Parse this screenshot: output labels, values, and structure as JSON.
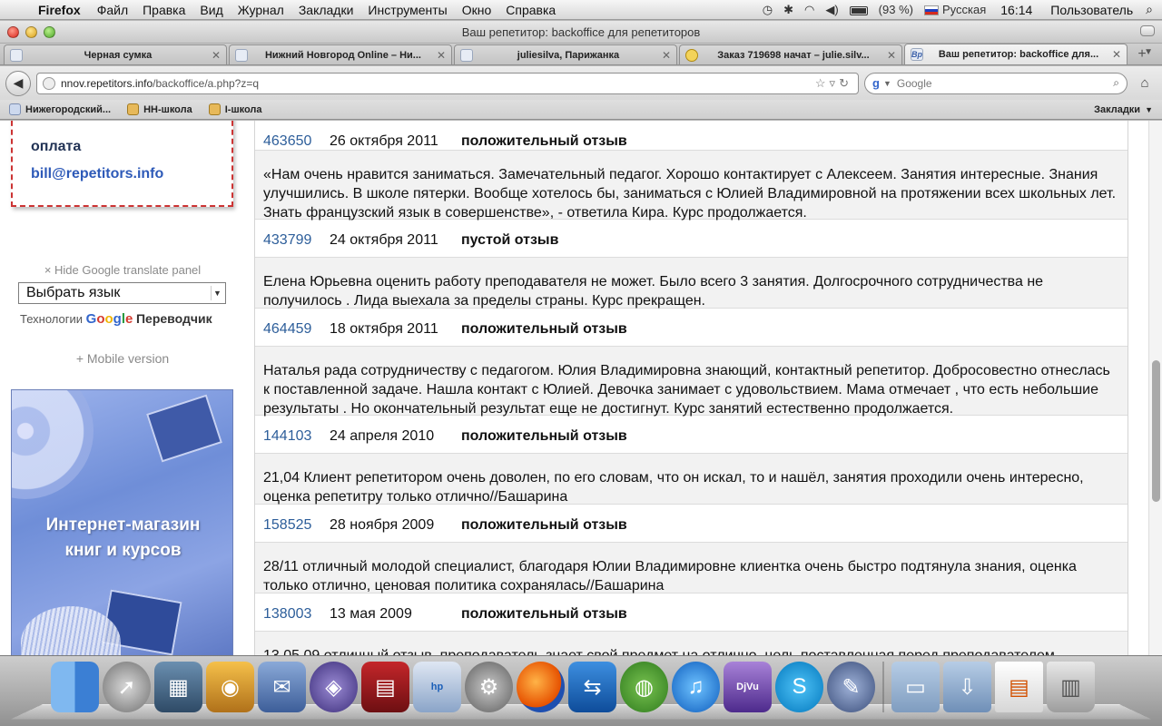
{
  "menubar": {
    "app": "Firefox",
    "items": [
      "Файл",
      "Правка",
      "Вид",
      "Журнал",
      "Закладки",
      "Инструменты",
      "Окно",
      "Справка"
    ],
    "battery": "(93 %)",
    "input_lang": "Русская",
    "time": "16:14",
    "user": "Пользователь"
  },
  "window": {
    "title": "Ваш репетитор: backoffice для репетиторов"
  },
  "tabs": [
    {
      "label": "Черная сумка",
      "favicon": "page-icon"
    },
    {
      "label": "Нижний Новгород Online – Ни...",
      "favicon": "page-icon"
    },
    {
      "label": "juliesilva, Парижанка",
      "favicon": "page-icon"
    },
    {
      "label": "Заказ 719698 начат – julie.silv...",
      "favicon": "mail-icon"
    },
    {
      "label": "Ваш репетитор: backoffice для...",
      "favicon": "bp-icon"
    }
  ],
  "tab_fav_text": "Bp",
  "navbar": {
    "url_domain": "nnov.repetitors.info",
    "url_path": "/backoffice/a.php?z=q",
    "url_scheme": "nnov.",
    "search_placeholder": "Google"
  },
  "bookmarks": {
    "items": [
      "Нижегородский...",
      "НН-школа",
      "I-школа"
    ],
    "right_label": "Закладки"
  },
  "sidebar": {
    "pay_label": "оплата",
    "pay_email": "bill@repetitors.info",
    "gt_hide": "× Hide Google translate panel",
    "gt_select": "Выбрать язык",
    "gt_powered_prefix": "Технологии",
    "gt_product": "Переводчик",
    "mobile_link": "+ Mobile version",
    "banner_text_1": "Интернет-магазин",
    "banner_text_2": "книг и курсов"
  },
  "reviews": [
    {
      "id": "463650",
      "date": "26 октября 2011",
      "type": "положительный отзыв",
      "text": "«Нам очень нравится заниматься. Замечательный педагог. Хорошо контактирует с Алексеем. Занятия интересные. Знания улучшились. В школе пятерки. Вообще хотелось бы, заниматься с Юлией Владимировной на протяжении всех школьных лет. Знать французский язык в совершенстве», - ответила Кира. Курс продолжается."
    },
    {
      "id": "433799",
      "date": "24 октября 2011",
      "type": "пустой отзыв",
      "text": "Елена Юрьевна оценить работу преподавателя не может. Было всего 3 занятия. Долгосрочного сотрудничества не получилось . Лида выехала за пределы страны. Курс прекращен."
    },
    {
      "id": "464459",
      "date": "18 октября 2011",
      "type": "положительный отзыв",
      "text": "Наталья рада сотрудничеству с педагогом. Юлия Владимировна знающий, контактный репетитор. Добросовестно отнеслась к поставленной задаче. Нашла контакт с Юлией. Девочка занимает с удовольствием. Мама отмечает , что есть небольшие результаты . Но окончательный результат еще не достигнут. Курс занятий естественно продолжается."
    },
    {
      "id": "144103",
      "date": "24 апреля 2010",
      "type": "положительный отзыв",
      "text": "21,04 Клиент репетитором очень доволен, по его словам, что он искал, то и нашёл, занятия проходили очень интересно, оценка репетитру только отлично//Башарина"
    },
    {
      "id": "158525",
      "date": "28 ноября 2009",
      "type": "положительный отзыв",
      "text": "28/11 отличный молодой специалист, благодаря Юлии Владимировне клиентка очень быстро подтянула знания, оценка только отлично, ценовая политика сохранялась//Башарина"
    },
    {
      "id": "138003",
      "date": "13 мая 2009",
      "type": "положительный отзыв",
      "text": "13.05.09 отличный отзыв, преподаватель знает свой предмет на отлично, цель поставленная перед преподавателем"
    }
  ],
  "dock": {
    "djvu_label": "DjVu",
    "hp_label": "hp"
  }
}
